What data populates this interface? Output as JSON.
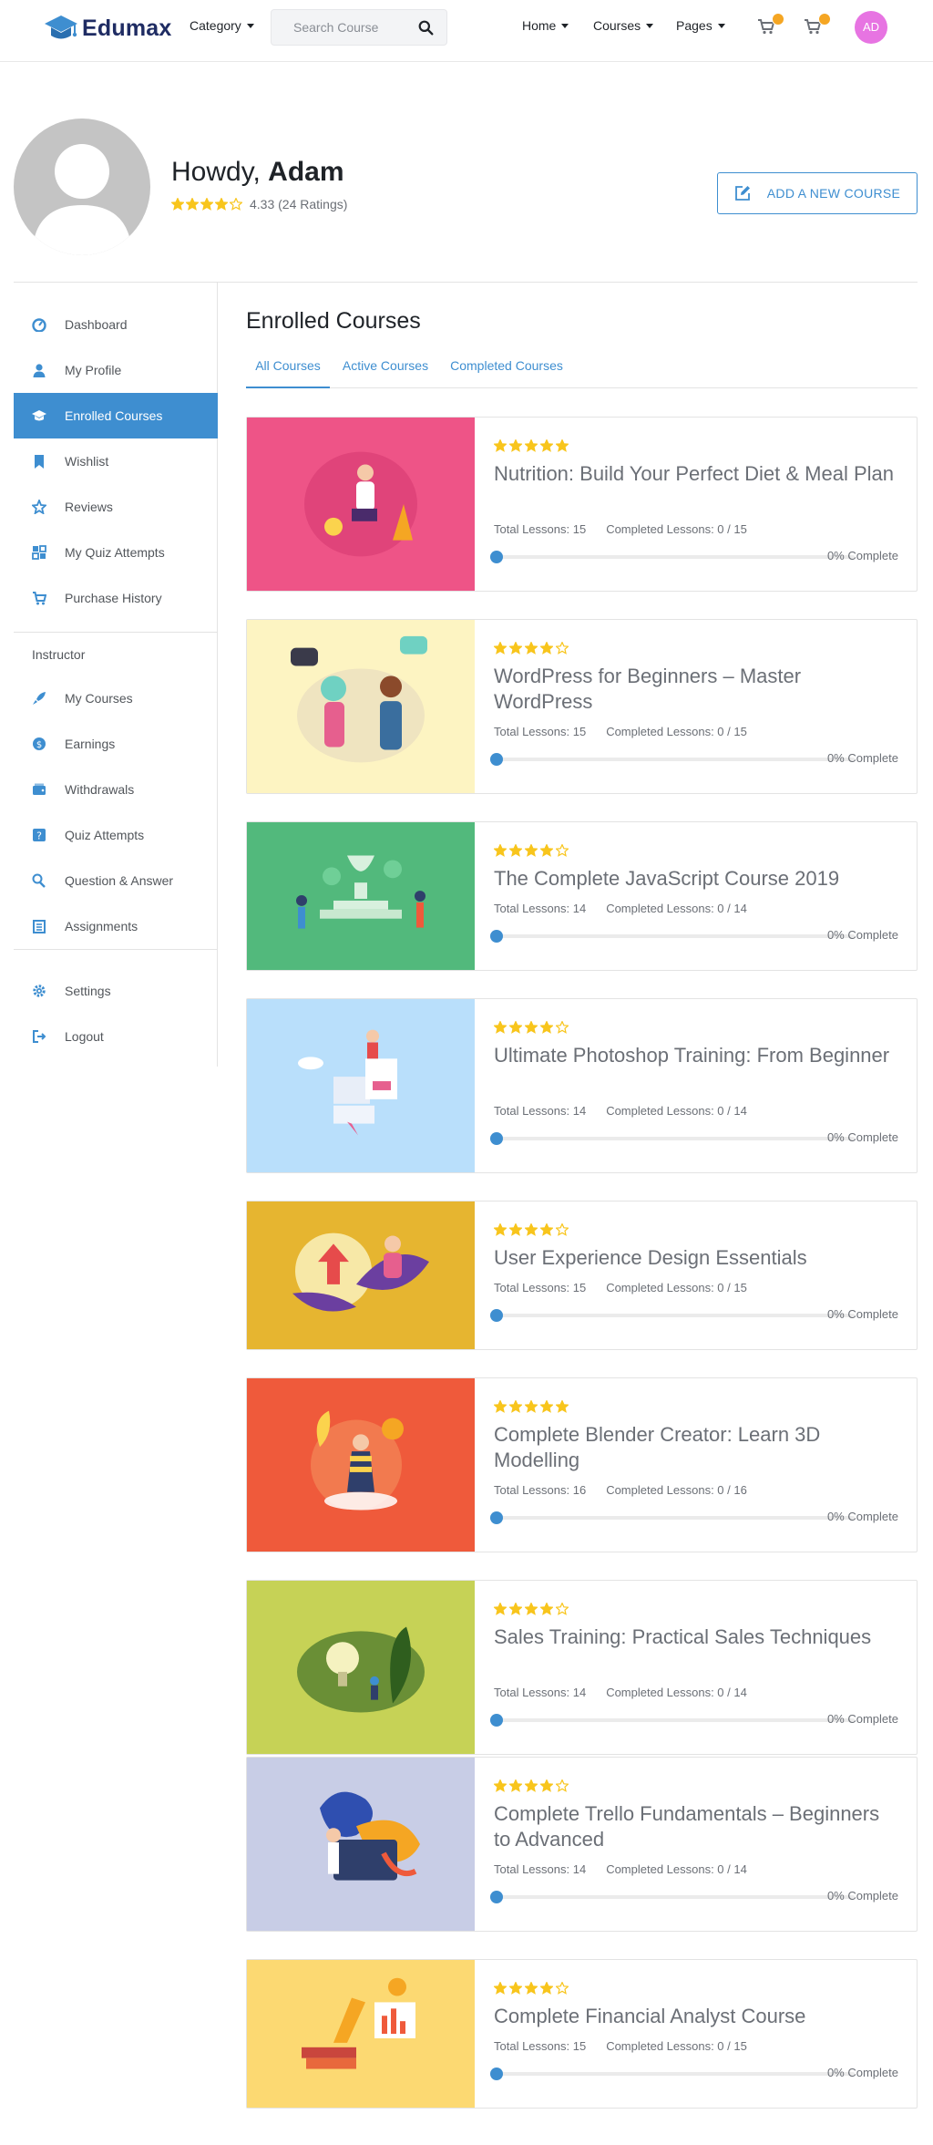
{
  "header": {
    "logo_text": "Edumax",
    "category_label": "Category",
    "search_placeholder": "Search Course",
    "nav": [
      {
        "label": "Home"
      },
      {
        "label": "Courses"
      },
      {
        "label": "Pages"
      }
    ],
    "avatar_initials": "AD",
    "badge_color": "#f5a623",
    "avatar_color": "#e774e2"
  },
  "profile": {
    "greeting": "Howdy, ",
    "name": "Adam",
    "rating_value": 4.33,
    "rating_text": "4.33 (24 Ratings)",
    "add_course_label": "ADD A NEW COURSE"
  },
  "sidebar": {
    "items": [
      {
        "label": "Dashboard",
        "icon": "dashboard-icon"
      },
      {
        "label": "My Profile",
        "icon": "user-icon"
      },
      {
        "label": "Enrolled Courses",
        "icon": "graduation-cap-icon",
        "active": true
      },
      {
        "label": "Wishlist",
        "icon": "bookmark-icon"
      },
      {
        "label": "Reviews",
        "icon": "star-icon"
      },
      {
        "label": "My Quiz Attempts",
        "icon": "puzzle-icon"
      },
      {
        "label": "Purchase History",
        "icon": "cart-icon"
      }
    ],
    "instructor_heading": "Instructor",
    "instructor_items": [
      {
        "label": "My Courses",
        "icon": "rocket-icon"
      },
      {
        "label": "Earnings",
        "icon": "dollar-icon"
      },
      {
        "label": "Withdrawals",
        "icon": "wallet-icon"
      },
      {
        "label": "Quiz Attempts",
        "icon": "quiz-icon"
      },
      {
        "label": "Question & Answer",
        "icon": "question-user-icon"
      },
      {
        "label": "Assignments",
        "icon": "clipboard-icon"
      }
    ],
    "bottom_items": [
      {
        "label": "Settings",
        "icon": "gear-icon"
      },
      {
        "label": "Logout",
        "icon": "logout-icon"
      }
    ]
  },
  "main": {
    "title": "Enrolled Courses",
    "tabs": [
      {
        "label": "All Courses",
        "active": true
      },
      {
        "label": "Active Courses"
      },
      {
        "label": "Completed Courses"
      }
    ]
  },
  "courses": [
    {
      "title": "Nutrition: Build Your Perfect Diet & Meal Plan",
      "rating": 5,
      "total_lessons": "Total Lessons: 15",
      "completed_lessons": "Completed Lessons: 0 / 15",
      "progress": 0,
      "progress_text": "0% Complete",
      "thumb_color": "#ee5487"
    },
    {
      "title": "WordPress for Beginners – Master WordPress",
      "rating": 4,
      "total_lessons": "Total Lessons: 15",
      "completed_lessons": "Completed Lessons: 0 / 15",
      "progress": 0,
      "progress_text": "0% Complete",
      "thumb_color": "#fdf4c2"
    },
    {
      "title": "The Complete JavaScript Course 2019",
      "rating": 4,
      "total_lessons": "Total Lessons: 14",
      "completed_lessons": "Completed Lessons: 0 / 14",
      "progress": 0,
      "progress_text": "0% Complete",
      "thumb_color": "#52b97c"
    },
    {
      "title": "Ultimate Photoshop Training: From Beginner",
      "rating": 4,
      "total_lessons": "Total Lessons: 14",
      "completed_lessons": "Completed Lessons: 0 / 14",
      "progress": 0,
      "progress_text": "0% Complete",
      "thumb_color": "#b9dffb"
    },
    {
      "title": "User Experience Design Essentials",
      "rating": 4,
      "total_lessons": "Total Lessons: 15",
      "completed_lessons": "Completed Lessons: 0 / 15",
      "progress": 0,
      "progress_text": "0% Complete",
      "thumb_color": "#e6b530"
    },
    {
      "title": "Complete Blender Creator: Learn 3D Modelling",
      "rating": 5,
      "total_lessons": "Total Lessons: 16",
      "completed_lessons": "Completed Lessons: 0 / 16",
      "progress": 0,
      "progress_text": "0% Complete",
      "thumb_color": "#ef5a3b"
    },
    {
      "title": "Sales Training: Practical Sales Techniques",
      "rating": 4,
      "total_lessons": "Total Lessons: 14",
      "completed_lessons": "Completed Lessons: 0 / 14",
      "progress": 0,
      "progress_text": "0% Complete",
      "thumb_color": "#c6d256"
    },
    {
      "title": "Complete Trello Fundamentals – Beginners to Advanced",
      "rating": 4,
      "total_lessons": "Total Lessons: 14",
      "completed_lessons": "Completed Lessons: 0 / 14",
      "progress": 0,
      "progress_text": "0% Complete",
      "thumb_color": "#c8cde6"
    },
    {
      "title": "Complete Financial Analyst Course",
      "rating": 4,
      "total_lessons": "Total Lessons: 15",
      "completed_lessons": "Completed Lessons: 0 / 15",
      "progress": 0,
      "progress_text": "0% Complete",
      "thumb_color": "#fcd972"
    }
  ],
  "colors": {
    "accent": "#3e8ed0",
    "star": "#f8c51c",
    "heading": "#1f2328"
  }
}
